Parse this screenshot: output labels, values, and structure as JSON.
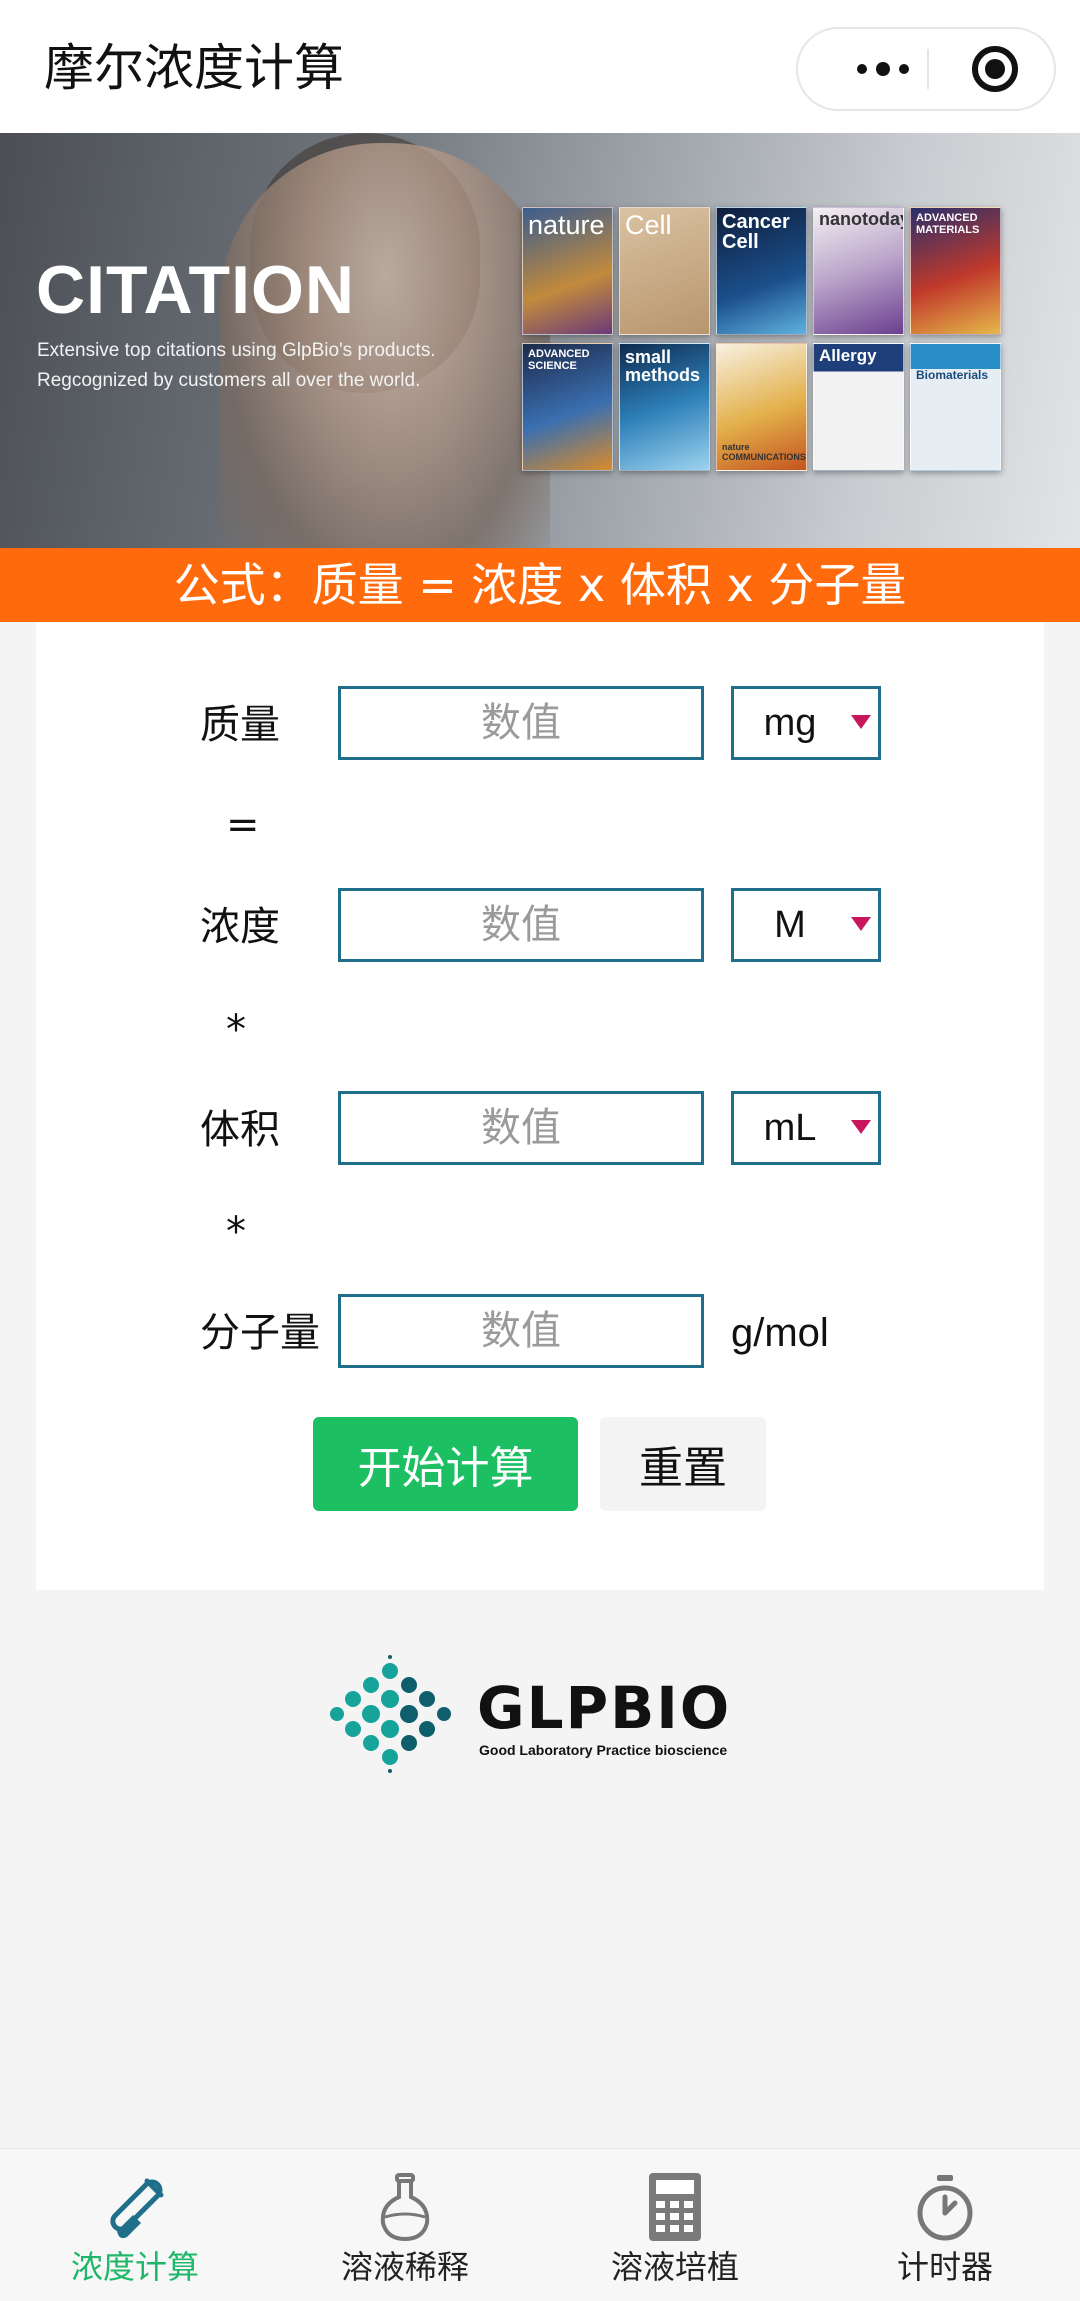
{
  "nav": {
    "title": "摩尔浓度计算"
  },
  "banner": {
    "title": "CITATION",
    "subtitle_line1": "Extensive top citations using GlpBio's products.",
    "subtitle_line2": "Regcognized by customers all over the world.",
    "journals": [
      "nature",
      "Cell",
      "Cancer Cell",
      "nanotoday",
      "ADVANCED MATERIALS",
      "ADVANCED SCIENCE",
      "small methods",
      "nature COMMUNICATIONS",
      "Allergy",
      "Biomaterials"
    ]
  },
  "formula": "公式：质量 = 浓度 x 体积 x 分子量",
  "form": {
    "mass": {
      "label": "质量",
      "placeholder": "数值",
      "unit": "mg"
    },
    "op1": "=",
    "concentration": {
      "label": "浓度",
      "placeholder": "数值",
      "unit": "M"
    },
    "op2": "*",
    "volume": {
      "label": "体积",
      "placeholder": "数值",
      "unit": "mL"
    },
    "op3": "*",
    "mw": {
      "label": "分子量",
      "placeholder": "数值",
      "unit": "g/mol"
    },
    "calc_button": "开始计算",
    "reset_button": "重置"
  },
  "brand": {
    "name": "GLPBIO",
    "tagline": "Good Laboratory Practice bioscience"
  },
  "tabs": [
    {
      "label": "浓度计算",
      "icon": "test-tube-icon",
      "active": true
    },
    {
      "label": "溶液稀释",
      "icon": "flask-icon",
      "active": false
    },
    {
      "label": "溶液培植",
      "icon": "calculator-icon",
      "active": false
    },
    {
      "label": "计时器",
      "icon": "stopwatch-icon",
      "active": false
    }
  ],
  "colors": {
    "accent_green": "#1dbf63",
    "formula_orange": "#ff6a0d",
    "input_border": "#1f6f8b",
    "select_arrow": "#c7165e"
  }
}
